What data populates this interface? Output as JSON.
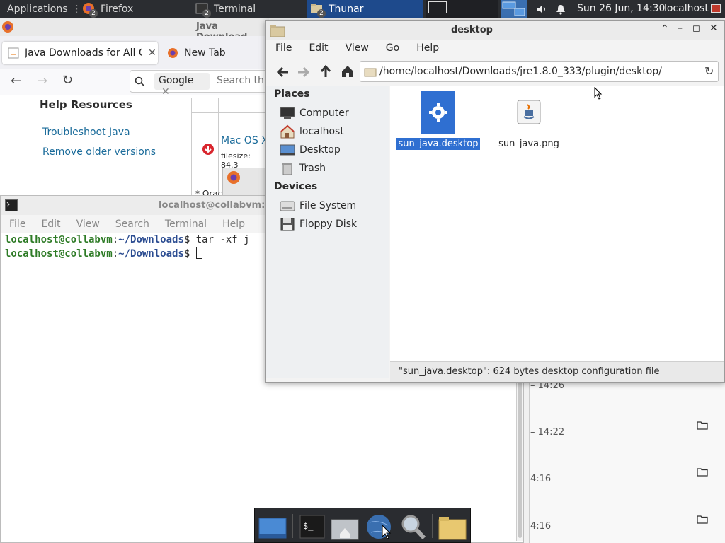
{
  "panel": {
    "applications": "Applications",
    "tasks": [
      {
        "label": "Firefox",
        "count": "2"
      },
      {
        "label": "Terminal",
        "count": "2"
      },
      {
        "label": "Thunar",
        "count": "2"
      }
    ],
    "clock": "Sun 26 Jun, 14:30",
    "user": "localhost"
  },
  "firefox": {
    "title": "Java Download",
    "tabs": [
      "Java Downloads for All O",
      "New Tab"
    ],
    "search_engine": "Google",
    "search_placeholder": "Search th",
    "help_heading": "Help Resources",
    "links": [
      "Troubleshoot Java",
      "Remove older versions"
    ],
    "download_label": "Mac OS X",
    "filesize": "filesize: 84.3",
    "footnote": "* Orac"
  },
  "terminal": {
    "title": "localhost@collabvm: ~",
    "menu": [
      "File",
      "Edit",
      "View",
      "Search",
      "Terminal",
      "Help"
    ],
    "lines": [
      {
        "user": "localhost@collabvm",
        "path": "~/Downloads",
        "cmd": "$ tar -xf j"
      },
      {
        "user": "localhost@collabvm",
        "path": "~/Downloads",
        "cmd": "$ "
      }
    ]
  },
  "bgwin": {
    "times": [
      "14:26",
      "14:22",
      "4:16",
      "4:16"
    ]
  },
  "thunar": {
    "title": "desktop",
    "menu": [
      "File",
      "Edit",
      "View",
      "Go",
      "Help"
    ],
    "location": "/home/localhost/Downloads/jre1.8.0_333/plugin/desktop/",
    "places_heading": "Places",
    "places": [
      "Computer",
      "localhost",
      "Desktop",
      "Trash"
    ],
    "devices_heading": "Devices",
    "devices": [
      "File System",
      "Floppy Disk"
    ],
    "files": [
      "sun_java.desktop",
      "sun_java.png"
    ],
    "status": "\"sun_java.desktop\": 624 bytes desktop configuration file"
  },
  "colors": {
    "selection": "#2f6fd1",
    "panel": "#2b2d31",
    "active_task": "#1e4a8c"
  }
}
